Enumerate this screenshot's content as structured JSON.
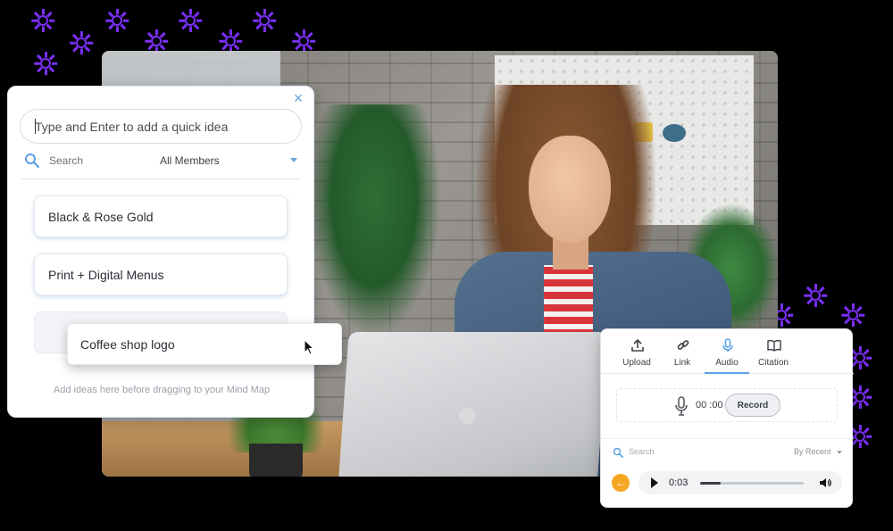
{
  "ideas_panel": {
    "quick_input_placeholder": "Type and Enter to add a quick idea",
    "search_label": "Search",
    "members_filter": "All Members",
    "ideas": [
      "Black & Rose Gold",
      "Print + Digital Menus"
    ],
    "dragging_idea": "Coffee shop logo",
    "hint": "Add ideas here before dragging to your Mind Map"
  },
  "media_panel": {
    "tabs": [
      {
        "label": "Upload",
        "icon": "upload-icon"
      },
      {
        "label": "Link",
        "icon": "link-icon"
      },
      {
        "label": "Audio",
        "icon": "microphone-icon",
        "active": true
      },
      {
        "label": "Citation",
        "icon": "book-icon"
      }
    ],
    "timer": "00 :00",
    "record_label": "Record",
    "search_label": "Search",
    "sort_label": "By Recent",
    "player_time": "0:03",
    "player_progress": 0.2
  },
  "colors": {
    "accent": "#5aa0e6",
    "sparkle": "#7b2ff7",
    "back_button": "#f5a623"
  }
}
